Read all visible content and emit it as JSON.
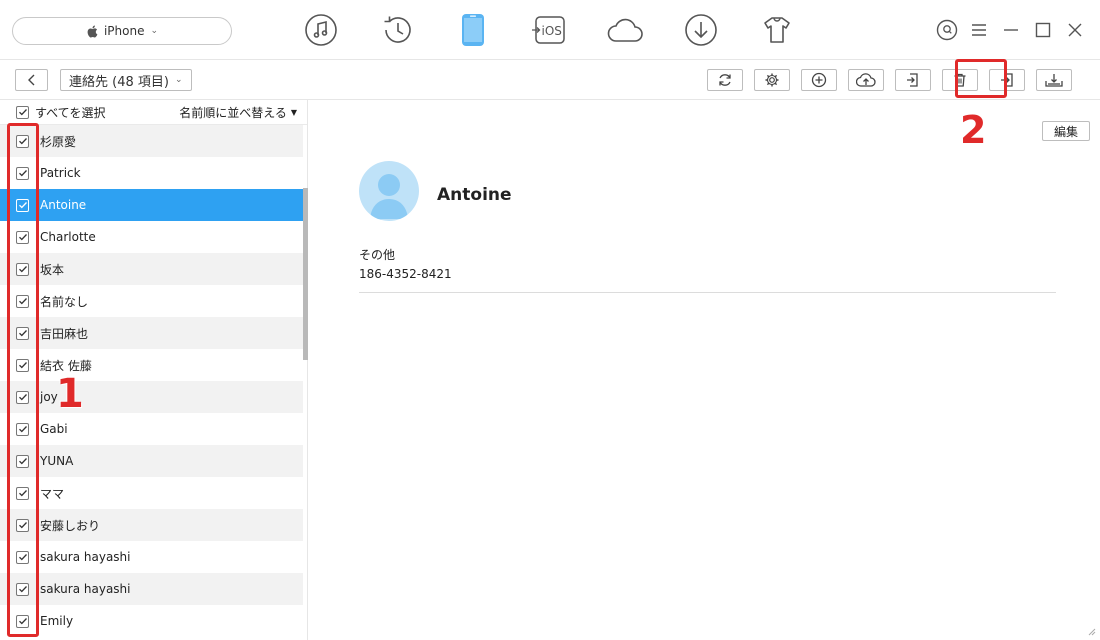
{
  "device": {
    "name": "iPhone"
  },
  "nav": {
    "icons": [
      "music-icon",
      "history-icon",
      "phone-icon",
      "to-ios-icon",
      "cloud-icon",
      "download-icon",
      "tshirt-icon"
    ],
    "to_ios_label": "iOS",
    "active": "phone-icon"
  },
  "toolbar": {
    "category_label": "連絡先 (48 項目)",
    "actions": [
      "refresh-icon",
      "settings-icon",
      "add-icon",
      "upload-cloud-icon",
      "export-icon",
      "delete-icon",
      "import-icon",
      "to-device-icon"
    ]
  },
  "list": {
    "select_all": "すべてを選択",
    "sort": "名前順に並べ替える",
    "contacts": [
      "杉原愛",
      "Patrick",
      "Antoine",
      "Charlotte",
      "坂本",
      "名前なし",
      "吉田麻也",
      "結衣 佐藤",
      "joy",
      "Gabi",
      "YUNA",
      "ママ",
      "安藤しおり",
      "sakura hayashi",
      "sakura hayashi",
      "Emily"
    ],
    "selected_index": 2
  },
  "detail": {
    "edit": "編集",
    "name": "Antoine",
    "field_label": "その他",
    "field_value": "186-4352-8421"
  },
  "annotations": {
    "step1": "1",
    "step2": "2"
  },
  "colors": {
    "accent": "#2ea1f2",
    "highlight": "#e02a2a"
  }
}
